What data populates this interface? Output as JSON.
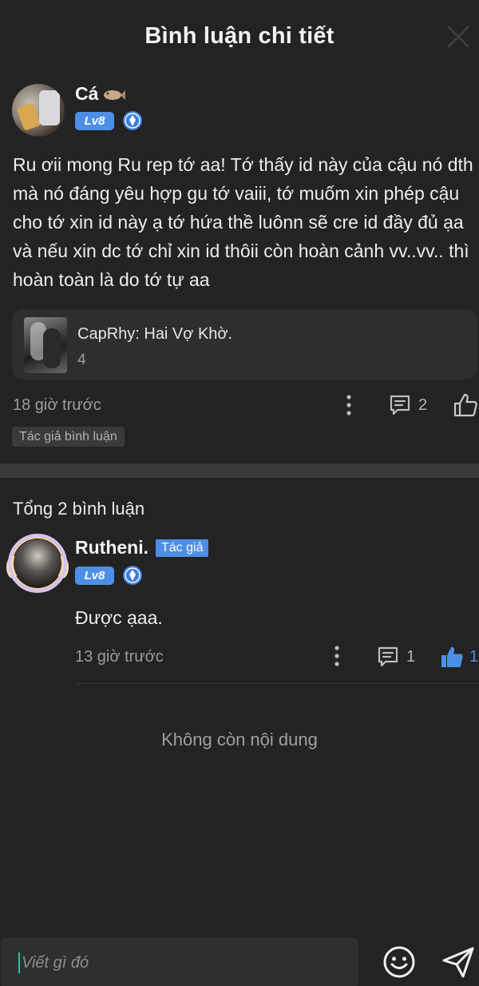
{
  "header": {
    "title": "Bình luận chi tiết"
  },
  "main_comment": {
    "author_name": "Cá",
    "level": "Lv8",
    "text": "Ru ơii mong Ru rep tớ aa! Tớ thấy id này của cậu nó dth mà nó đáng yêu hợp gu tớ vaiii, tớ muốm xin phép cậu cho tớ xin id này ạ tớ hứa thề luônn sẽ cre id đầy đủ ạa và nếu xin dc tớ chỉ xin id thôii còn hoàn cảnh vv..vv.. thì hoàn toàn là do tớ tự aa",
    "story": {
      "title": "CapRhy: Hai Vợ Khờ.",
      "count": "4"
    },
    "time": "18 giờ trước",
    "reply_count": "2",
    "author_tag": "Tác giả bình luận"
  },
  "replies_section": {
    "total_label": "Tổng 2 bình luận",
    "replies": [
      {
        "author_name": "Rutheni.",
        "author_chip": "Tác giả",
        "level": "Lv8",
        "text": "Được ạaa.",
        "time": "13 giờ trước",
        "reply_count": "1",
        "like_count": "1"
      }
    ],
    "end_label": "Không còn nội dung"
  },
  "input_bar": {
    "placeholder": "Viết gì đó"
  },
  "colors": {
    "accent": "#4d8fe6",
    "background": "#232323"
  }
}
